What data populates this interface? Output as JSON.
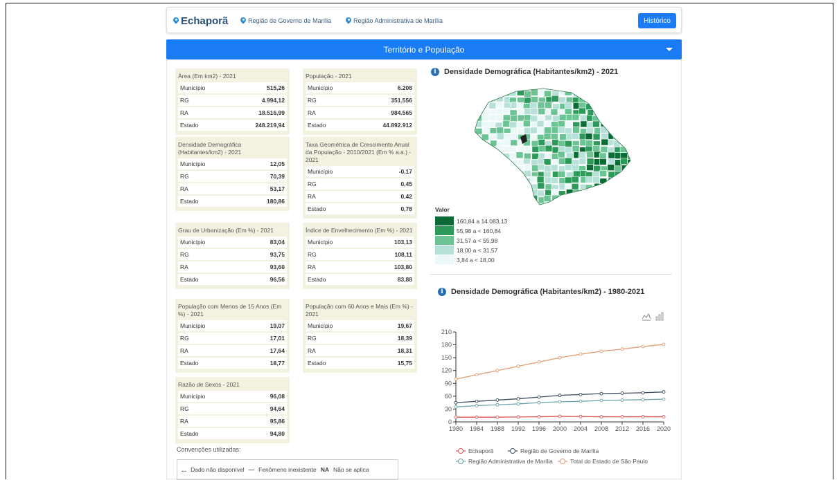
{
  "header": {
    "city": "Echaporã",
    "region_gov": "Região de Governo de Marília",
    "region_adm": "Região Administrativa de Marília",
    "history_button": "Histórico"
  },
  "section": {
    "title": "Território e População"
  },
  "cards": [
    {
      "title": "Área (Em km2) - 2021",
      "rows": [
        {
          "label": "Município",
          "value": "515,26"
        },
        {
          "label": "RG",
          "value": "4.994,12"
        },
        {
          "label": "RA",
          "value": "18.516,99"
        },
        {
          "label": "Estado",
          "value": "248.219,94"
        }
      ]
    },
    {
      "title": "População - 2021",
      "rows": [
        {
          "label": "Município",
          "value": "6.208"
        },
        {
          "label": "RG",
          "value": "351.556"
        },
        {
          "label": "RA",
          "value": "984.565"
        },
        {
          "label": "Estado",
          "value": "44.892.912"
        }
      ]
    },
    {
      "title": "Densidade Demográfica (Habitantes/km2) - 2021",
      "rows": [
        {
          "label": "Município",
          "value": "12,05"
        },
        {
          "label": "RG",
          "value": "70,39"
        },
        {
          "label": "RA",
          "value": "53,17"
        },
        {
          "label": "Estado",
          "value": "180,86"
        }
      ]
    },
    {
      "title": "Taxa Geométrica de Crescimento Anual da População - 2010/2021 (Em % a.a.) - 2021",
      "rows": [
        {
          "label": "Município",
          "value": "-0,17"
        },
        {
          "label": "RG",
          "value": "0,45"
        },
        {
          "label": "RA",
          "value": "0,42"
        },
        {
          "label": "Estado",
          "value": "0,78"
        }
      ]
    },
    {
      "title": "Grau de Urbanização (Em %) - 2021",
      "rows": [
        {
          "label": "Município",
          "value": "83,04"
        },
        {
          "label": "RG",
          "value": "93,75"
        },
        {
          "label": "RA",
          "value": "93,60"
        },
        {
          "label": "Estado",
          "value": "96,56"
        }
      ]
    },
    {
      "title": "Índice de Envelhecimento (Em %) - 2021",
      "rows": [
        {
          "label": "Município",
          "value": "103,13"
        },
        {
          "label": "RG",
          "value": "108,11"
        },
        {
          "label": "RA",
          "value": "103,80"
        },
        {
          "label": "Estado",
          "value": "83,88"
        }
      ]
    },
    {
      "title": "População com Menos de 15 Anos (Em %) - 2021",
      "rows": [
        {
          "label": "Município",
          "value": "19,07"
        },
        {
          "label": "RG",
          "value": "17,01"
        },
        {
          "label": "RA",
          "value": "17,64"
        },
        {
          "label": "Estado",
          "value": "18,77"
        }
      ]
    },
    {
      "title": "População com 60 Anos e Mais (Em %) - 2021",
      "rows": [
        {
          "label": "Município",
          "value": "19,67"
        },
        {
          "label": "RG",
          "value": "18,39"
        },
        {
          "label": "RA",
          "value": "18,31"
        },
        {
          "label": "Estado",
          "value": "15,75"
        }
      ]
    },
    {
      "title": "Razão de Sexos - 2021",
      "rows": [
        {
          "label": "Município",
          "value": "96,08"
        },
        {
          "label": "RG",
          "value": "94,64"
        },
        {
          "label": "RA",
          "value": "95,86"
        },
        {
          "label": "Estado",
          "value": "94,80"
        }
      ]
    }
  ],
  "conventions": {
    "title": "Convenções utilizadas:",
    "na_symbol": "...",
    "na_text": "Dado não disponível",
    "dash_symbol": "—",
    "dash_text": "Fenômeno inexistente",
    "nap_symbol": "NA",
    "nap_text": "Não se aplica"
  },
  "map": {
    "title": "Densidade Demográfica (Habitantes/km2) - 2021",
    "legend_title": "Valor",
    "legend": [
      {
        "label": "160,84 a 14.083,13",
        "color": "#0b6b35"
      },
      {
        "label": "55,98 a < 160,84",
        "color": "#2e9a5a"
      },
      {
        "label": "31,57 a < 55,98",
        "color": "#6cc394"
      },
      {
        "label": "18,00 a < 31,57",
        "color": "#b7e0d8"
      },
      {
        "label": "3,84 a < 18,00",
        "color": "#ecf7f8"
      }
    ]
  },
  "chart_title": "Densidade Demográfica (Habitantes/km2) - 1980-2021",
  "chart_data": {
    "type": "line",
    "x": [
      1980,
      1984,
      1988,
      1992,
      1996,
      2000,
      2004,
      2008,
      2012,
      2016,
      2021
    ],
    "xticks": [
      "1980",
      "1984",
      "1988",
      "1992",
      "1996",
      "2000",
      "2004",
      "2008",
      "2012",
      "2016",
      "2020"
    ],
    "yticks": [
      "0",
      "30",
      "60",
      "90",
      "120",
      "150",
      "180",
      "210"
    ],
    "ylim": [
      0,
      210
    ],
    "series": [
      {
        "name": "Echaporã",
        "color": "#e05252",
        "values": [
          11,
          11,
          11,
          11.5,
          12,
          13,
          12.5,
          12,
          12,
          12,
          12
        ]
      },
      {
        "name": "Região de Governo de Marília",
        "color": "#3c4a5c",
        "values": [
          45,
          48,
          51,
          54,
          58,
          62,
          64,
          66,
          67,
          68,
          70
        ]
      },
      {
        "name": "Região Administrativa de Marília",
        "color": "#6aa3a8",
        "values": [
          35,
          38,
          40,
          42,
          45,
          47,
          48,
          50,
          51,
          52,
          53
        ]
      },
      {
        "name": "Total do Estado de São Paulo",
        "color": "#e39b74",
        "values": [
          100,
          110,
          120,
          130,
          140,
          150,
          158,
          165,
          170,
          176,
          181
        ]
      }
    ]
  }
}
